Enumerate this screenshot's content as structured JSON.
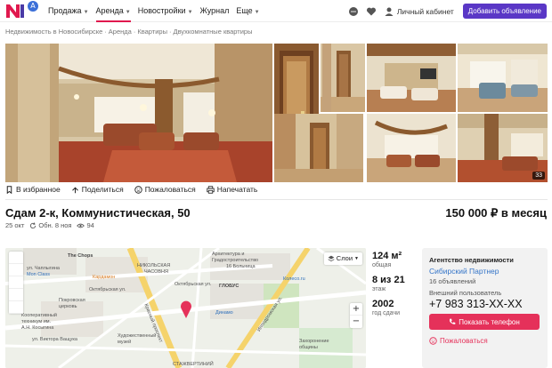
{
  "header": {
    "logo_letters": "N",
    "logo_badge": "A",
    "nav": [
      {
        "label": "Продажа",
        "has_dropdown": true,
        "active": false
      },
      {
        "label": "Аренда",
        "has_dropdown": true,
        "active": true
      },
      {
        "label": "Новостройки",
        "has_dropdown": true,
        "active": false
      },
      {
        "label": "Журнал",
        "has_dropdown": false,
        "active": false
      },
      {
        "label": "Еще",
        "has_dropdown": true,
        "active": false
      }
    ],
    "cabinet_label": "Личный кабинет",
    "add_button": "Добавить объявление",
    "accent_color": "#e0194e",
    "button_color": "#5a37c6"
  },
  "breadcrumb": [
    "Недвижимость в Новосибирске",
    "Аренда",
    "Квартиры",
    "Двухкомнатные квартиры"
  ],
  "gallery": {
    "photo_count": "33"
  },
  "actions": {
    "favorite": "В избранное",
    "share": "Поделиться",
    "complain": "Пожаловаться",
    "print": "Напечатать"
  },
  "listing": {
    "title": "Сдам 2-к, Коммунистическая, 50",
    "price": "150 000 ₽ в месяц",
    "date": "25 окт",
    "updated": "Обн. 8 ноя",
    "views": "94"
  },
  "map": {
    "layers_label": "Слои",
    "zoom_in": "+",
    "zoom_out": "−",
    "labels": {
      "the_chops": "The Chops",
      "nikolskaya": "НИКОЛЬСКАЯ",
      "chasovnya": "ЧАСОВНЯ",
      "architecture": "Архитектура и",
      "gradostroitelstvo": "Градостроительство",
      "chaplygina": "ул. Чаплыгина",
      "bolnitsa": "16 Больница",
      "kardamon": "Кардамон",
      "oktyabrskaya1": "Октябрьская ул.",
      "oktyabrskaya2": "Октябрьская ул.",
      "pokrovskaya": "Покровская",
      "tserkov": "церковь",
      "globus": "ГЛОБУС",
      "kolesoru": "Колесо.ru",
      "kooperativny": "Кооперативный",
      "tekhnikum": "техникум им.",
      "kosygina": "А.Н. Косыгина",
      "viktora": "ул. Виктора Ващука",
      "kvartal": "квартал",
      "dinamo": "Динамо",
      "khudozhestvenny": "Художественный",
      "muzey": "музей",
      "zakharova": "Захарова",
      "pravoslavnaya": "Православная",
      "zakhoronenie": "Захоронение",
      "obshchina": "общины",
      "kirova": "ул. Кирова",
      "stadion": "СТАЖВЕРТИНИЙ",
      "mon_class": "Mon Class",
      "kommunisticheskaya": "Коммунистическая ул.",
      "krasny": "Красный проспект",
      "serebr": "Серебренниковская ул.",
      "ippodromskaya": "Ипподромская ул."
    }
  },
  "facts": [
    {
      "value": "124 м²",
      "label": "общая"
    },
    {
      "value": "8 из 21",
      "label": "этаж"
    },
    {
      "value": "2002",
      "label": "год сдачи"
    }
  ],
  "agency": {
    "type": "Агентство недвижимости",
    "name": "Сибирский Партнер",
    "count": "16 объявлений",
    "user": "Внешний пользователь",
    "phone": "+7 983 313-XX-XX",
    "show_phone": "Показать телефон",
    "complain": "Пожаловаться",
    "accent": "#e5315a"
  }
}
